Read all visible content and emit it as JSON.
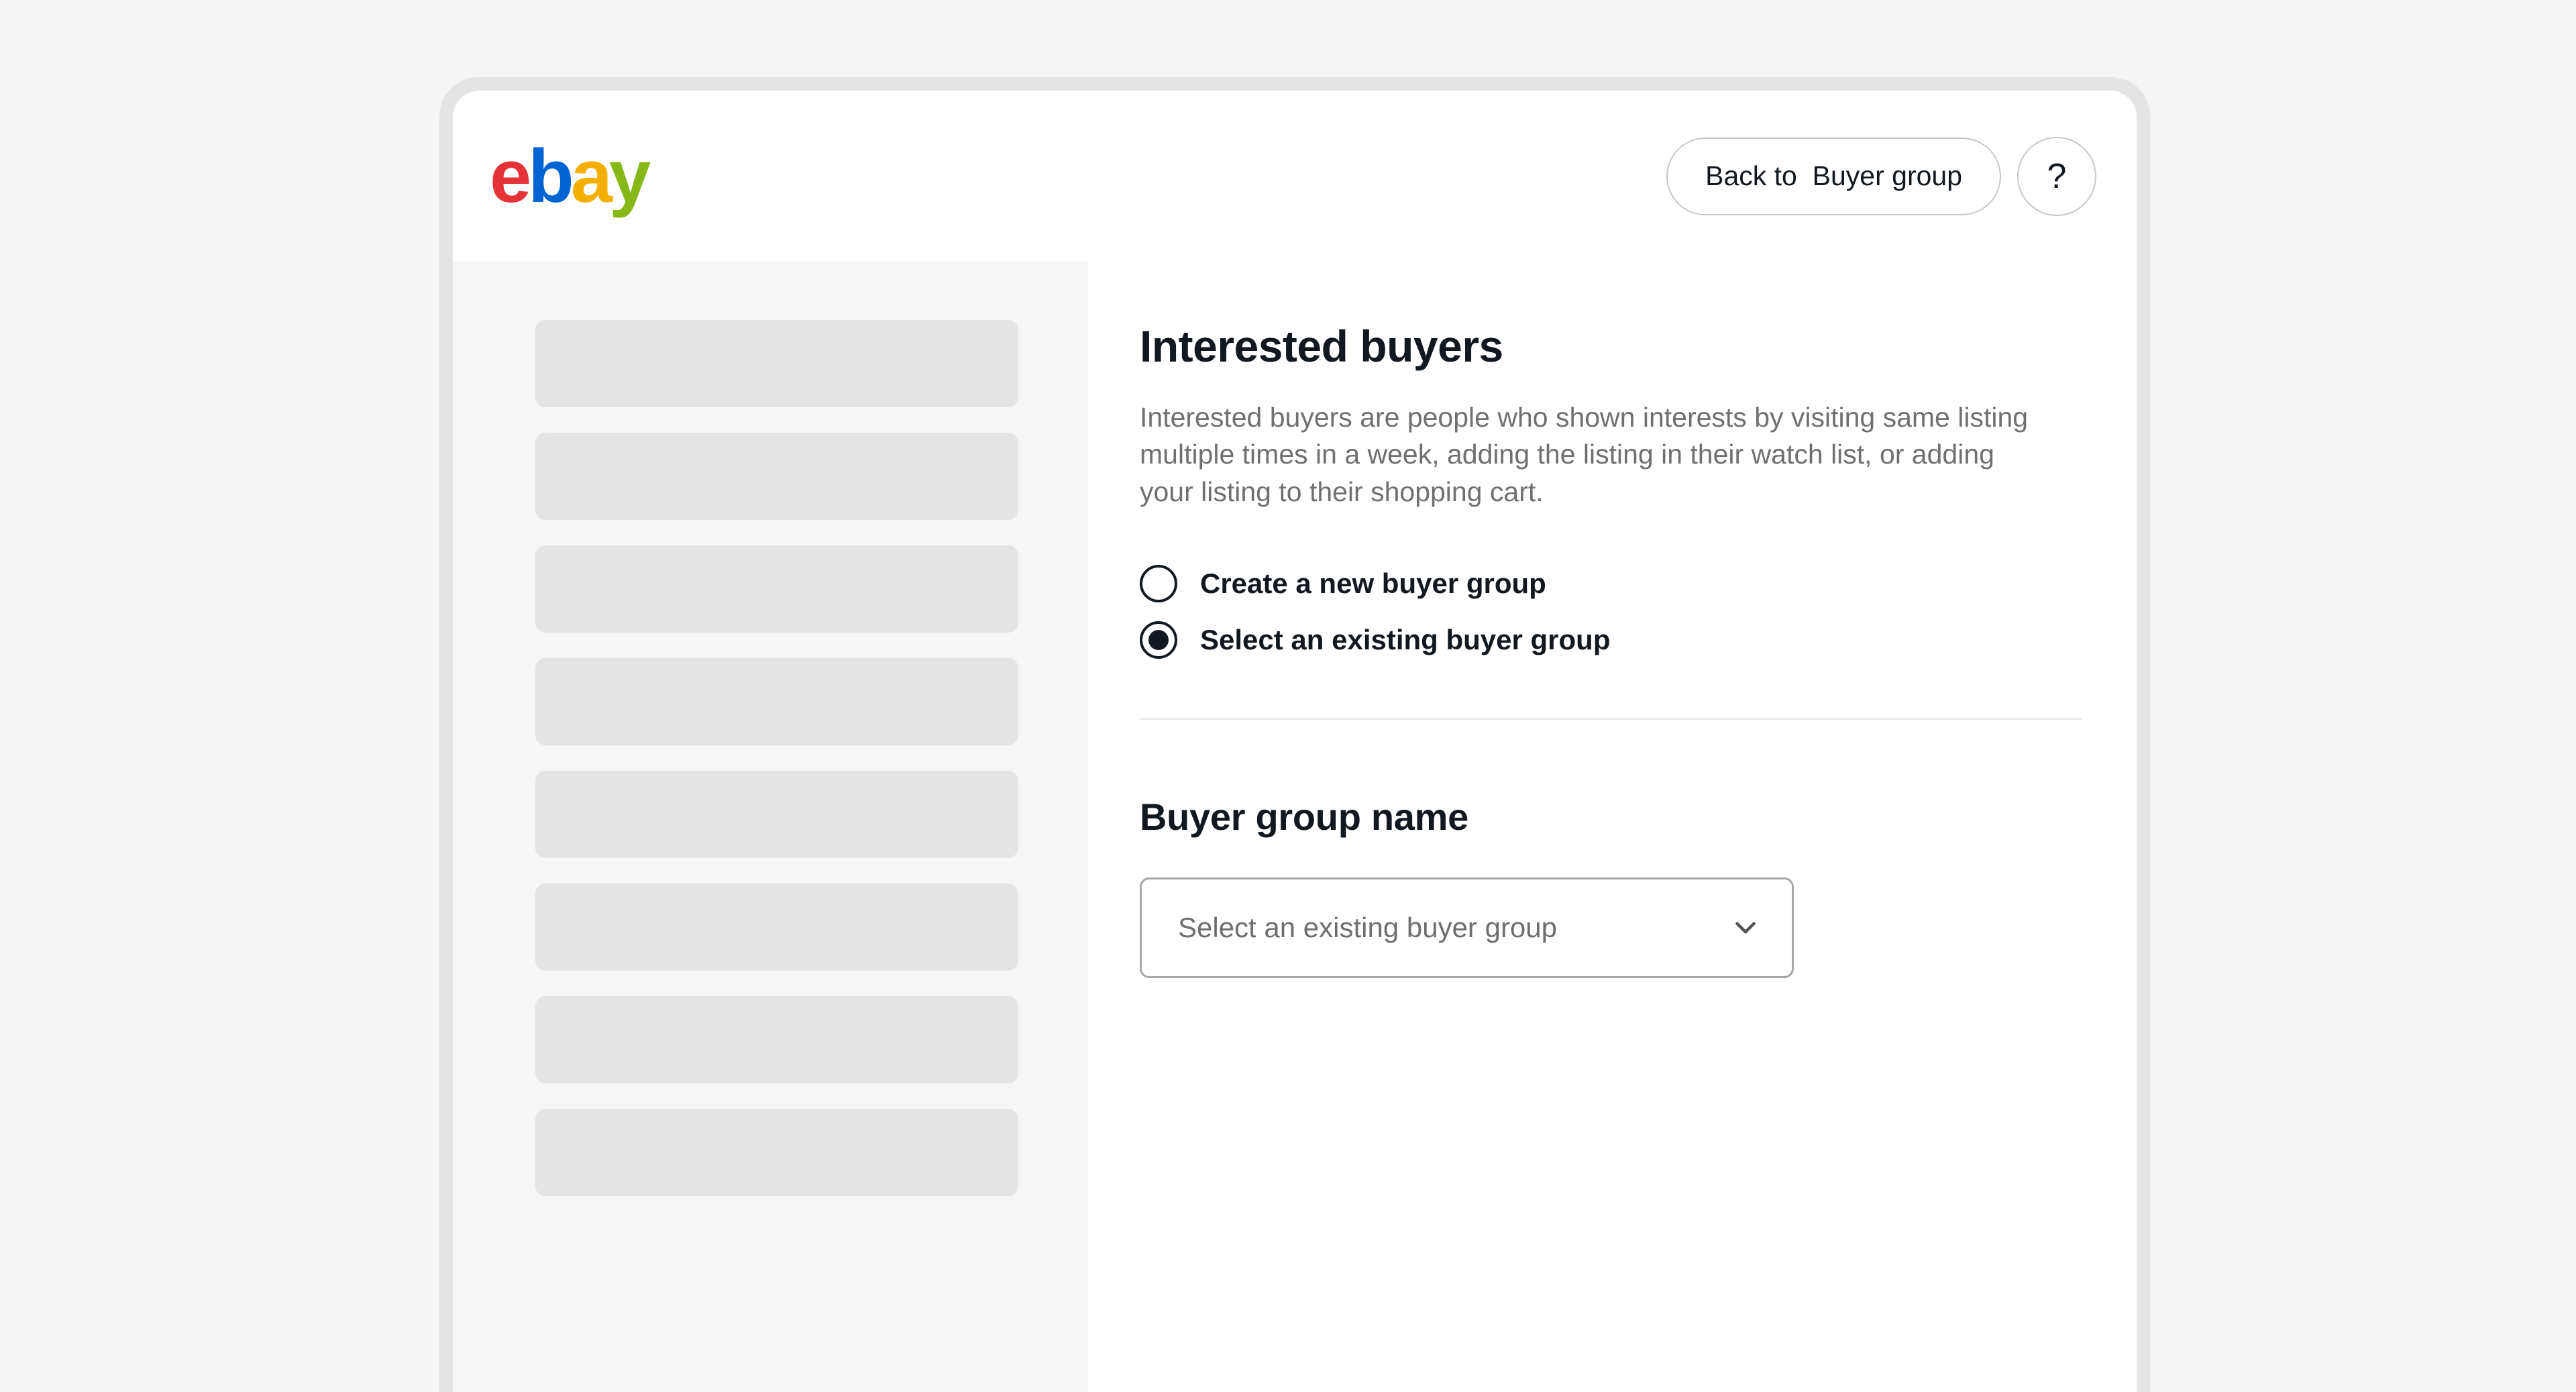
{
  "header": {
    "logo": {
      "alt": "ebay-logo",
      "letters": [
        "e",
        "b",
        "a",
        "y"
      ],
      "colors": [
        "#e53238",
        "#0064d2",
        "#f5af02",
        "#86b817"
      ]
    },
    "back_button_label": "Back to  Buyer group",
    "help_button_label": "?"
  },
  "sidebar": {
    "placeholder_count": 8,
    "placeholders": [
      {
        "id": 1
      },
      {
        "id": 2
      },
      {
        "id": 3
      },
      {
        "id": 4
      },
      {
        "id": 5
      },
      {
        "id": 6
      },
      {
        "id": 7
      },
      {
        "id": 8
      }
    ]
  },
  "main": {
    "title": "Interested buyers",
    "description": "Interested buyers are people who shown interests by visiting same listing multiple times in a week, adding the listing in their watch list, or adding your listing to their shopping cart.",
    "radio_options": [
      {
        "label": "Create a new buyer group",
        "selected": false
      },
      {
        "label": "Select an existing buyer group",
        "selected": true
      }
    ],
    "field_label": "Buyer group name",
    "select": {
      "placeholder": "Select an existing buyer group",
      "value": "Select an existing buyer group",
      "icon": "chevron-down-icon"
    }
  },
  "colors": {
    "page_background": "#f5f5f5",
    "device_bezel": "#e4e4e4",
    "screen": "#ffffff",
    "sidebar": "#f6f6f6",
    "skeleton": "#e4e4e4",
    "text_primary": "#111820",
    "text_secondary": "#707070",
    "border": "#c7c7c7",
    "divider": "#ebebeb"
  }
}
